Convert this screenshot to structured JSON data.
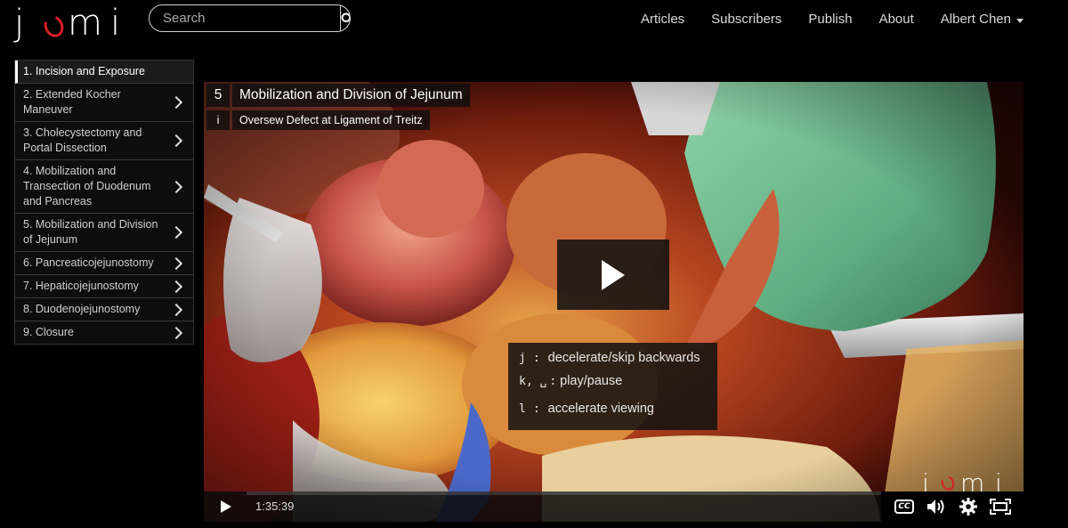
{
  "brand": {
    "letters": [
      "j",
      "o",
      "m",
      "i"
    ],
    "accent_color": "#d81f26"
  },
  "search": {
    "placeholder": "Search",
    "value": "",
    "icon": "search-icon"
  },
  "nav": {
    "articles": "Articles",
    "subscribers": "Subscribers",
    "publish": "Publish",
    "about": "About",
    "user": "Albert Chen"
  },
  "chapters": [
    "1. Incision and Exposure",
    "2. Extended Kocher Maneuver",
    "3. Cholecystectomy and Portal Dissection",
    "4. Mobilization and Transection of Duodenum and Pancreas",
    "5. Mobilization and Division of Jejunum",
    "6. Pancreaticojejunostomy",
    "7. Hepaticojejunostomy",
    "8. Duodenojejunostomy",
    "9. Closure"
  ],
  "video": {
    "chapter_number": "5",
    "chapter_title": "Mobilization and Division of Jejunum",
    "sub_marker": "i",
    "sub_title": "Oversew Defect at Ligament of Treitz",
    "shortcuts": [
      {
        "key": "j",
        "sep": ":",
        "action": "decelerate/skip backwards"
      },
      {
        "key": "k, ␣",
        "sep": ":",
        "action": "play/pause"
      },
      {
        "key": "l",
        "sep": ":",
        "action": "accelerate viewing"
      }
    ],
    "time": "1:35:39",
    "progress": 0,
    "controls": [
      "play-icon",
      "cc-icon",
      "volume-icon",
      "settings-icon",
      "fullscreen-icon"
    ],
    "cc_label": "CC"
  }
}
